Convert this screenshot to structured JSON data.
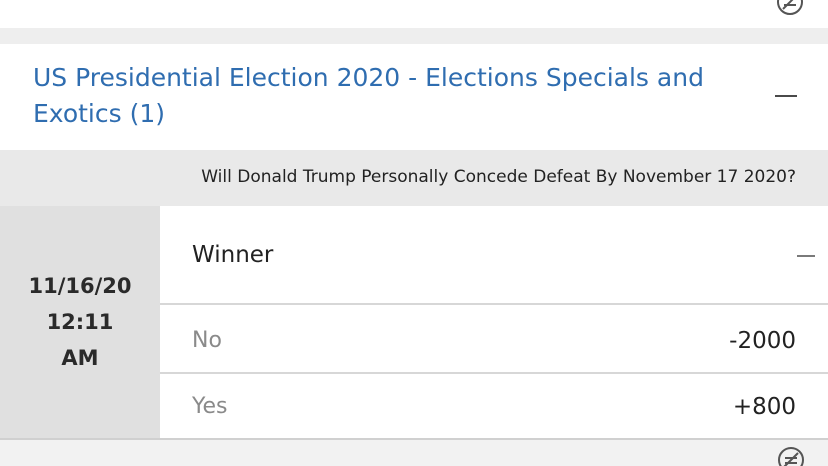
{
  "section": {
    "title": "US Presidential Election 2020 - Elections Specials and Exotics (1)"
  },
  "event": {
    "question": "Will Donald Trump Personally Concede Defeat By November 17 2020?",
    "date": "11/16/20",
    "time": "12:11",
    "meridiem": "AM"
  },
  "market": {
    "title": "Winner",
    "outcomes": [
      {
        "name": "No",
        "odds": "-2000"
      },
      {
        "name": "Yes",
        "odds": "+800"
      }
    ]
  },
  "icons": {
    "top": "no-bet-circle-icon",
    "bottom": "no-bet-circle-icon",
    "collapse": "minus-icon"
  },
  "colors": {
    "link_blue": "#2f6db0",
    "header_gray": "#e9e9e9",
    "date_gray": "#e0e0e0"
  }
}
